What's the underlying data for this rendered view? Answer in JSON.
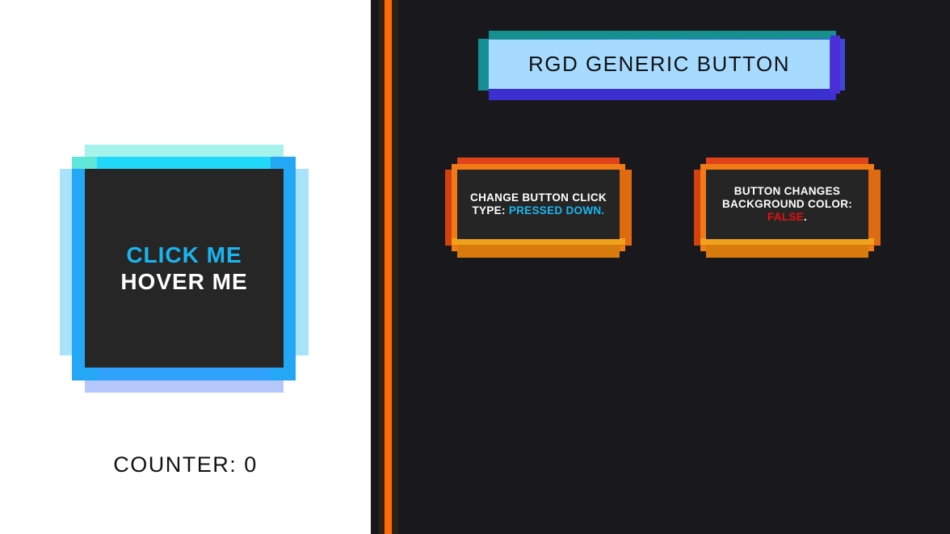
{
  "main_button": {
    "click_label": "CLICK ME",
    "hover_label": "HOVER ME",
    "colors": {
      "click_text": "#19b5ef",
      "face": "#262626",
      "border": "#24a8f6"
    }
  },
  "counter": {
    "label": "COUNTER: 0"
  },
  "header_button": {
    "title": "RGD GENERIC BUTTON",
    "face_color": "#a6daff"
  },
  "option_click_type": {
    "line1": "CHANGE BUTTON CLICK",
    "prefix": "TYPE: ",
    "value": "PRESSED DOWN.",
    "value_color": "#19b5ef"
  },
  "option_bg_color": {
    "line1": "BUTTON CHANGES",
    "line2": "BACKGROUND COLOR:",
    "value": "FALSE",
    "suffix": ".",
    "value_color": "#e8100f"
  },
  "colors": {
    "divider_accent": "#ff6a00",
    "dark_bg": "#19181d"
  }
}
